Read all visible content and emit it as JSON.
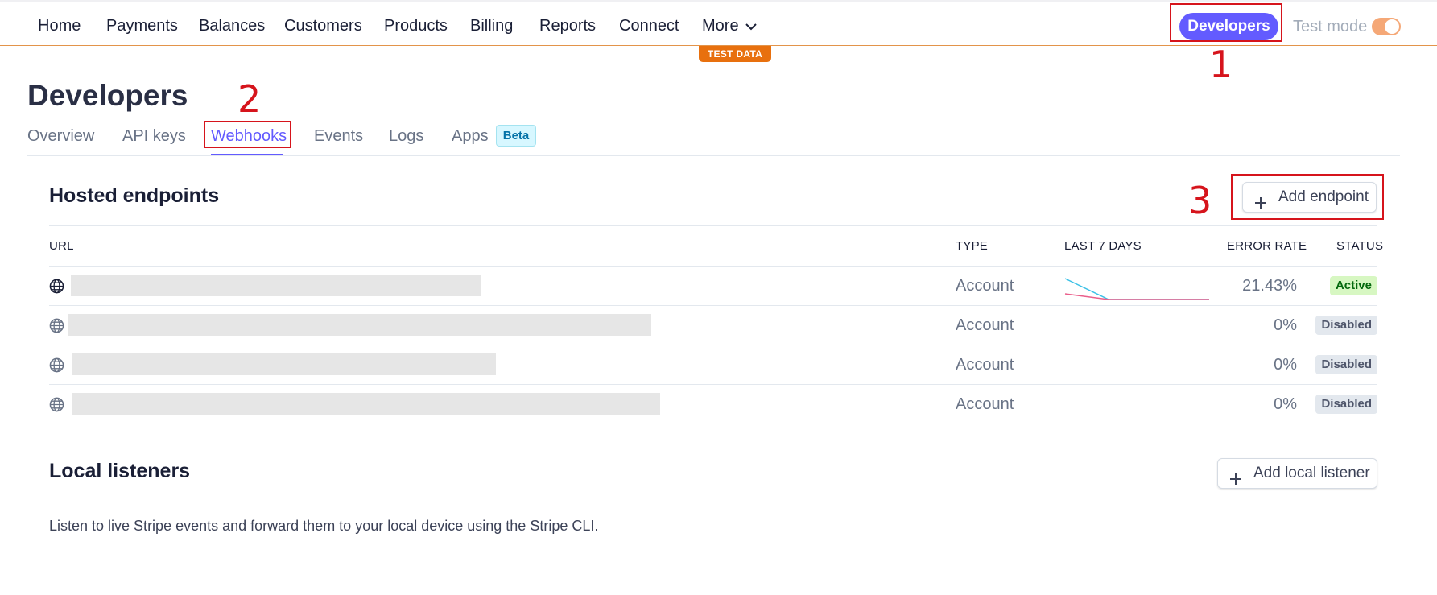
{
  "nav": {
    "items": [
      "Home",
      "Payments",
      "Balances",
      "Customers",
      "Products",
      "Billing",
      "Reports",
      "Connect"
    ],
    "more_label": "More",
    "developers_label": "Developers",
    "test_mode_label": "Test mode",
    "test_data_label": "TEST DATA"
  },
  "annotations": [
    "1",
    "2",
    "3"
  ],
  "page": {
    "title": "Developers",
    "tabs": [
      "Overview",
      "API keys",
      "Webhooks",
      "Events",
      "Logs",
      "Apps"
    ],
    "beta_label": "Beta"
  },
  "hosted": {
    "title": "Hosted endpoints",
    "add_label": "Add endpoint",
    "columns": [
      "URL",
      "TYPE",
      "LAST 7 DAYS",
      "ERROR RATE",
      "STATUS"
    ],
    "rows": [
      {
        "type": "Account",
        "error_rate": "21.43%",
        "status": "Active"
      },
      {
        "type": "Account",
        "error_rate": "0%",
        "status": "Disabled"
      },
      {
        "type": "Account",
        "error_rate": "0%",
        "status": "Disabled"
      },
      {
        "type": "Account",
        "error_rate": "0%",
        "status": "Disabled"
      }
    ]
  },
  "local": {
    "title": "Local listeners",
    "add_label": "Add local listener",
    "description": "Listen to live Stripe events and forward them to your local device using the Stripe CLI."
  },
  "colors": {
    "accent": "#635bff",
    "test_orange": "#e8700e",
    "annotation_red": "#d6141c",
    "active_green": "#05690d"
  }
}
